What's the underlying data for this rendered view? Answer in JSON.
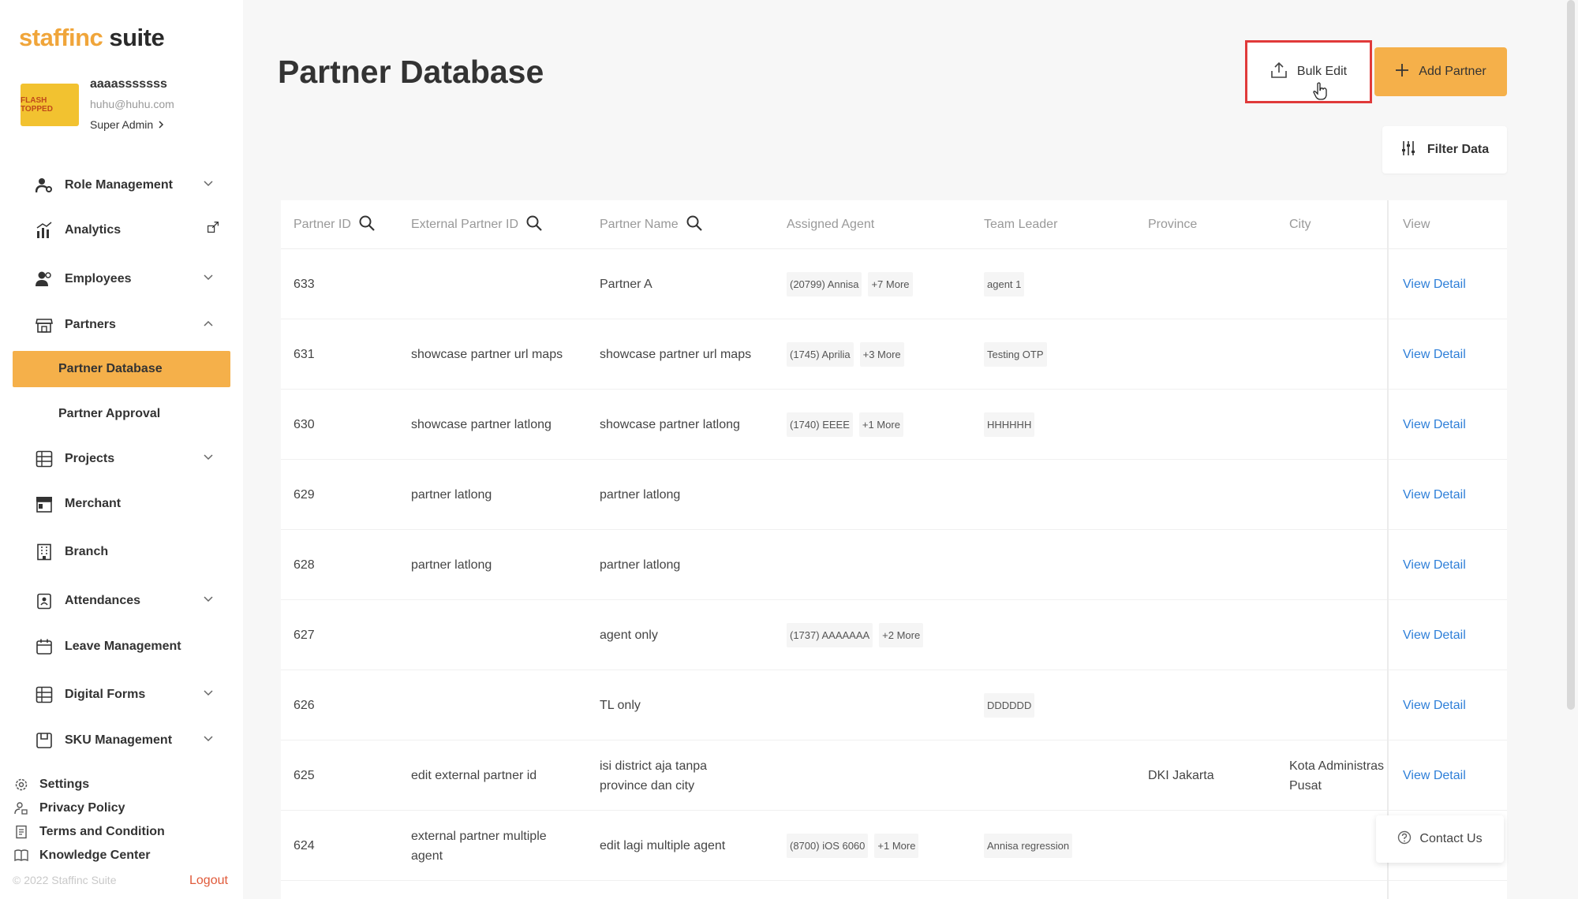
{
  "logo": {
    "brand": "staffinc",
    "suite": " suite"
  },
  "profile": {
    "avatar_text": "FLASH TOPPED",
    "name": "aaaasssssss",
    "email": "huhu@huhu.com",
    "role": "Super Admin"
  },
  "nav": {
    "role_management": "Role Management",
    "analytics": "Analytics",
    "employees": "Employees",
    "partners": "Partners",
    "partner_database": "Partner Database",
    "partner_approval": "Partner Approval",
    "projects": "Projects",
    "merchant": "Merchant",
    "branch": "Branch",
    "attendances": "Attendances",
    "leave_management": "Leave Management",
    "digital_forms": "Digital Forms",
    "sku_management": "SKU Management"
  },
  "footer": {
    "settings": "Settings",
    "privacy": "Privacy Policy",
    "terms": "Terms and Condition",
    "knowledge": "Knowledge Center",
    "copyright": "© 2022 Staffinc Suite",
    "logout": "Logout"
  },
  "page": {
    "title": "Partner Database",
    "bulk_edit": "Bulk Edit",
    "add_partner": "Add Partner",
    "filter_data": "Filter Data",
    "contact_us": "Contact Us"
  },
  "table": {
    "headers": {
      "partner_id": "Partner ID",
      "external_id": "External Partner ID",
      "partner_name": "Partner Name",
      "assigned_agent": "Assigned Agent",
      "team_leader": "Team Leader",
      "province": "Province",
      "city": "City",
      "view": "View"
    },
    "rows": [
      {
        "id": "633",
        "ext": "",
        "name": "Partner A",
        "agent": "(20799) Annisa",
        "more": "+7 More",
        "tl": "agent 1",
        "province": "",
        "city": "",
        "view": "View Detail"
      },
      {
        "id": "631",
        "ext": "showcase partner url maps",
        "name": "showcase partner url maps",
        "agent": "(1745) Aprilia",
        "more": "+3 More",
        "tl": "Testing OTP",
        "province": "",
        "city": "",
        "view": "View Detail"
      },
      {
        "id": "630",
        "ext": "showcase partner latlong",
        "name": "showcase partner latlong",
        "agent": "(1740) EEEE",
        "more": "+1 More",
        "tl": "HHHHHH",
        "province": "",
        "city": "",
        "view": "View Detail"
      },
      {
        "id": "629",
        "ext": "partner latlong",
        "name": "partner latlong",
        "agent": "",
        "more": "",
        "tl": "",
        "province": "",
        "city": "",
        "view": "View Detail"
      },
      {
        "id": "628",
        "ext": "partner latlong",
        "name": "partner latlong",
        "agent": "",
        "more": "",
        "tl": "",
        "province": "",
        "city": "",
        "view": "View Detail"
      },
      {
        "id": "627",
        "ext": "",
        "name": "agent only",
        "agent": "(1737) AAAAAAA",
        "more": "+2 More",
        "tl": "",
        "province": "",
        "city": "",
        "view": "View Detail"
      },
      {
        "id": "626",
        "ext": "",
        "name": "TL only",
        "agent": "",
        "more": "",
        "tl": "DDDDDD",
        "province": "",
        "city": "",
        "view": "View Detail"
      },
      {
        "id": "625",
        "ext": "edit external partner id",
        "name": "isi district aja tanpa province dan city",
        "agent": "",
        "more": "",
        "tl": "",
        "province": "DKI Jakarta",
        "city": "Kota Administras Pusat",
        "view": "View Detail"
      },
      {
        "id": "624",
        "ext": "external partner multiple agent",
        "name": "edit lagi multiple agent",
        "agent": "(8700) iOS 6060",
        "more": "+1 More",
        "tl": "Annisa regression",
        "province": "",
        "city": "",
        "view": ""
      }
    ]
  }
}
